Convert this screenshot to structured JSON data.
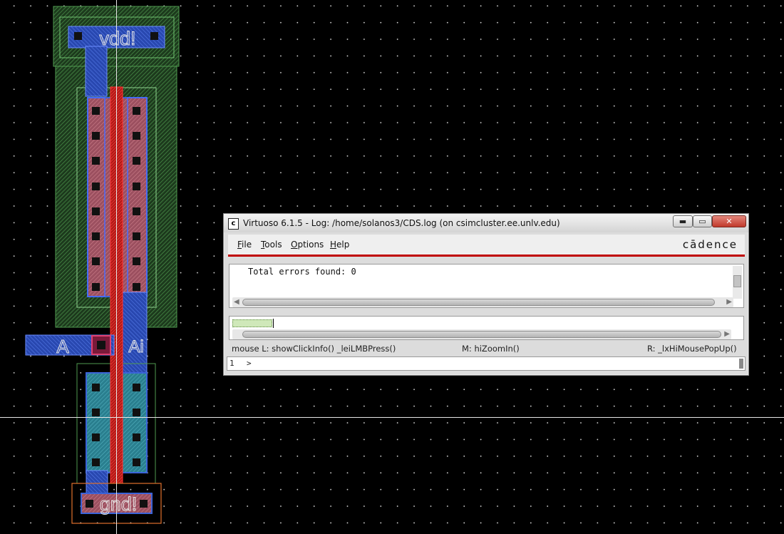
{
  "canvas": {
    "background": "#000000",
    "grid_dot_color": "#cfcfcf"
  },
  "pins": {
    "vdd": "vdd!",
    "gnd": "gnd!",
    "input": "A",
    "output": "Ai"
  },
  "layer_colors": {
    "nwell": "#3c8c3c",
    "metal1": "#3b63d8",
    "poly": "#e02020",
    "diffusion": "#c05a6a",
    "contact": "#111111",
    "pad_border": "#e0702c"
  },
  "log_window": {
    "title": "Virtuoso 6.1.5 - Log: /home/solanos3/CDS.log (on csimcluster.ee.unlv.edu)",
    "icon": "c-icon",
    "title_buttons": {
      "minimize": "▬",
      "maximize": "▭",
      "close": "✕"
    },
    "menu": {
      "file": "File",
      "tools": "Tools",
      "options": "Options",
      "help": "Help"
    },
    "brand": "cādence",
    "brand_color": "#c00000",
    "log_text": "Total errors found: 0",
    "mouse_left": "mouse L: showClickInfo() _leiLMBPress()",
    "mouse_middle": "M: hiZoomIn()",
    "mouse_right": "R: _lxHiMousePopUp()",
    "line_number": "1",
    "prompt": ">"
  }
}
